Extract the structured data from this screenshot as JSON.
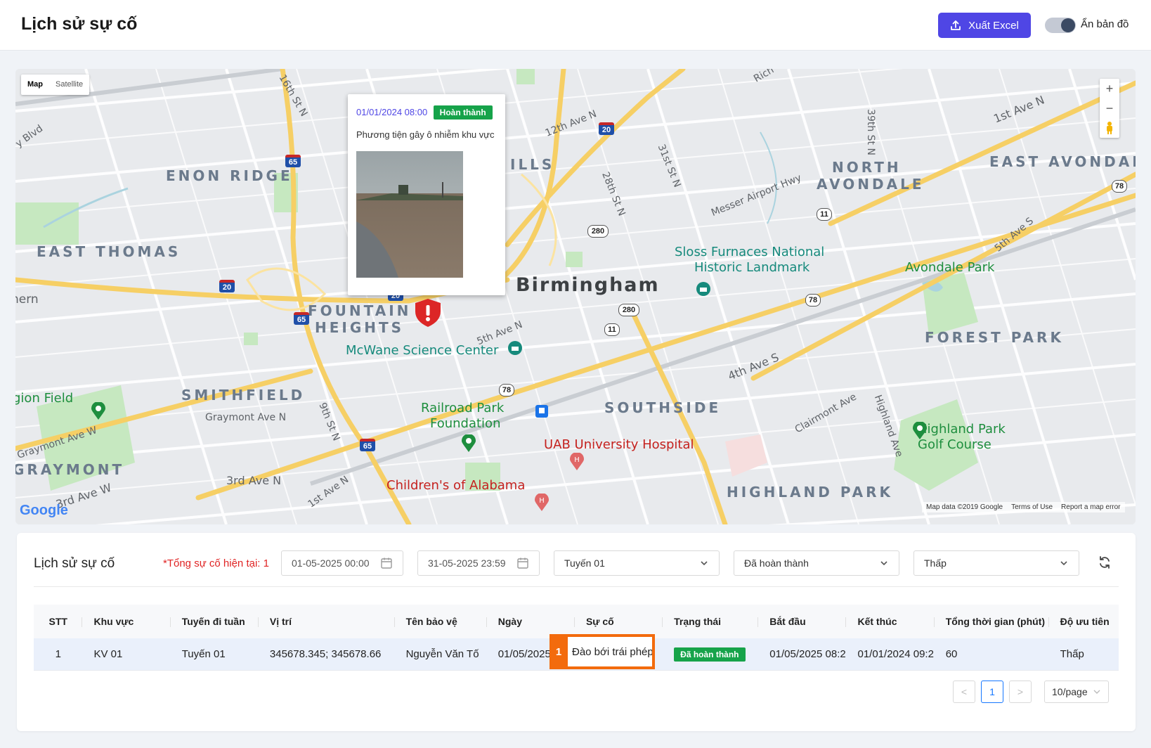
{
  "header": {
    "title": "Lịch sử sự cố",
    "export_label": "Xuất Excel",
    "toggle_label": "Ẩn bản đồ"
  },
  "map": {
    "type_map": "Map",
    "type_satellite": "Satellite",
    "zoom_in": "+",
    "zoom_out": "−",
    "popup": {
      "timestamp": "01/01/2024 08:00",
      "status": "Hoàn thành",
      "description": "Phương tiện gây ô nhiễm khu vực"
    },
    "labels": {
      "city": "Birmingham",
      "enon_ridge": "ENON RIDGE",
      "east_thomas": "EAST THOMAS",
      "fountain_heights_1": "FOUNTAIN",
      "fountain_heights_2": "HEIGHTS",
      "smithfield": "SMITHFIELD",
      "graymont": "GRAYMONT",
      "southside": "SOUTHSIDE",
      "highland_park": "HIGHLAND PARK",
      "forest_park": "FOREST PARK",
      "north_avondale_1": "NORTH",
      "north_avondale_2": "AVONDALE",
      "east_avondale": "EAST AVONDAL",
      "ills": "ILLS",
      "sloss_1": "Sloss Furnaces National",
      "sloss_2": "Historic Landmark",
      "avondale_park": "Avondale Park",
      "mcwane": "McWane Science Center",
      "railroad_1": "Railroad Park",
      "railroad_2": "Foundation",
      "uab": "UAB University Hospital",
      "childrens": "Children's of Alabama",
      "highland_golf_1": "Highland Park",
      "highland_golf_2": "Golf Course",
      "legion_field": "gion Field",
      "ern": "nern",
      "st_1st_ave_n": "1st Ave N",
      "st_3rd_ave_n": "3rd Ave N",
      "st_4th_ave_s": "4th Ave S",
      "st_5th_ave_n": "5th Ave N",
      "st_5th_ave_s": "5th Ave S",
      "st_12th_ave_n": "12th Ave N",
      "st_28th_st_n": "28th St N",
      "st_31st_st_n": "31st St N",
      "st_39th_st_n": "39th St N",
      "st_16th_st_n": "16th St N",
      "st_9th_st_n": "9th St N",
      "st_messer": "Messer Airport Hwy",
      "st_graymont_ave_n": "Graymont Ave N",
      "st_graymont_ave_w": "Graymont Ave W",
      "st_3rd_ave_w": "3rd Ave W",
      "st_1st_ave_n_w": "1st Ave N",
      "st_clairmont": "Clairmont Ave",
      "st_highland_ave": "Highland Ave",
      "st_y_blvd": "y Blvd",
      "st_rich": "Rich"
    },
    "shields": {
      "i65_a": "65",
      "i65_b": "65",
      "i65_c": "65",
      "i20_a": "20",
      "i20_b": "20",
      "i20_c": "20",
      "us11_a": "11",
      "us11_b": "11",
      "us78_a": "78",
      "us78_b": "78",
      "us78_c": "78",
      "us280_a": "280",
      "us280_b": "280"
    },
    "attribution": {
      "data": "Map data ©2019 Google",
      "terms": "Terms of Use",
      "report": "Report a map error",
      "logo": "Google"
    }
  },
  "panel": {
    "title": "Lịch sử sự cố",
    "total": "*Tổng sự cố hiện tại: 1",
    "filters": {
      "from_date": "01-05-2025 00:00",
      "to_date": "31-05-2025 23:59",
      "route": "Tuyến 01",
      "status": "Đã hoàn thành",
      "priority": "Thấp"
    }
  },
  "table": {
    "columns": [
      "STT",
      "Khu vực",
      "Tuyến đi tuần",
      "Vị trí",
      "Tên bảo vệ",
      "Ngày",
      "Sự cố",
      "Trạng thái",
      "Bắt đầu",
      "Kết thúc",
      "Tổng thời gian (phút)",
      "Độ ưu tiên"
    ],
    "rows": [
      {
        "stt": "1",
        "area": "KV 01",
        "route": "Tuyến 01",
        "position": "345678.345; 345678.66",
        "guard": "Nguyễn Văn Tố",
        "date": "01/05/2025",
        "incident": "Đào bới trái phép",
        "status": "Đã hoàn thành",
        "start": "01/05/2025 08:2",
        "end": "01/01/2024 09:2",
        "duration": "60",
        "priority": "Thấp"
      }
    ],
    "highlight_marker": "1"
  },
  "pagination": {
    "prev": "<",
    "current": "1",
    "next": ">",
    "page_size": "10/page"
  },
  "colors": {
    "primary": "#4f46e5",
    "success": "#16a34a",
    "danger": "#e02424",
    "highlight": "#f36b0d",
    "highway": "#f6cf65"
  }
}
